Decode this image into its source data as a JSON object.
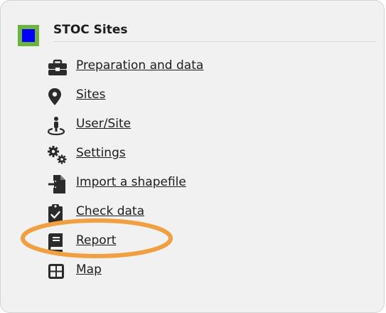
{
  "panel": {
    "title": "STOC Sites",
    "brand_color": "#6db33f",
    "brand_inner_color": "#0000ff"
  },
  "menu": {
    "items": [
      {
        "label": "Preparation and data",
        "icon": "briefcase-icon"
      },
      {
        "label": "Sites",
        "icon": "map-pin-icon"
      },
      {
        "label": "User/Site",
        "icon": "user-location-icon"
      },
      {
        "label": "Settings",
        "icon": "gears-icon"
      },
      {
        "label": "Import a shapefile",
        "icon": "file-import-icon"
      },
      {
        "label": "Check data",
        "icon": "clipboard-check-icon"
      },
      {
        "label": "Report",
        "icon": "book-icon"
      },
      {
        "label": "Map",
        "icon": "grid-icon"
      }
    ]
  },
  "annotation": {
    "highlight_color": "#f0a040",
    "highlighted_item": "Report"
  }
}
